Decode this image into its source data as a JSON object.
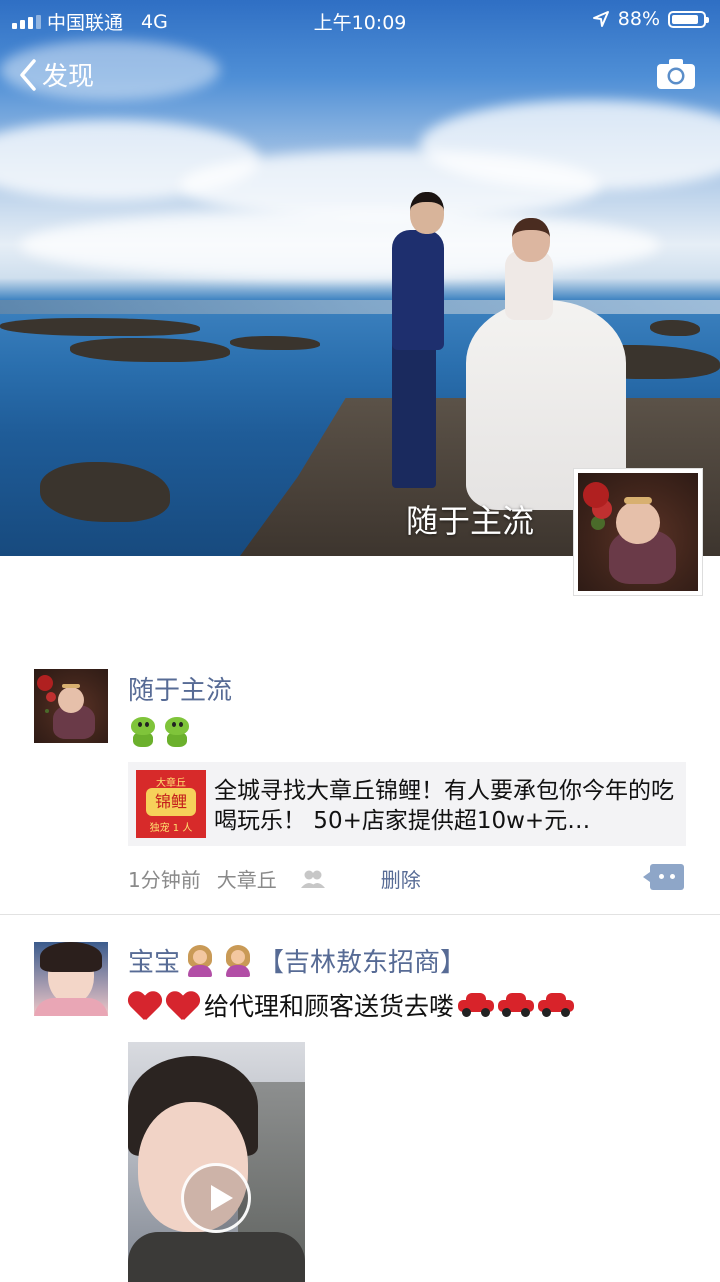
{
  "status_bar": {
    "carrier": "中国联通",
    "network": "4G",
    "time": "上午10:09",
    "battery": "88%",
    "battery_level": 0.88
  },
  "nav": {
    "back_label": "发现",
    "back_icon": "chevron-left-icon",
    "camera_icon": "camera-icon"
  },
  "cover": {
    "user_name": "随于主流"
  },
  "posts": [
    {
      "name": "随于主流",
      "emoji": [
        "frog-emoji",
        "frog-emoji"
      ],
      "link": {
        "thumb_top": "大章丘",
        "thumb_mid": "锦鲤",
        "thumb_bot": "独宠 1 人",
        "title": "全城寻找大章丘锦鲤！有人要承包你今年的吃喝玩乐！ 50+店家提供超10w+元…"
      },
      "time": "1分钟前",
      "location": "大章丘",
      "privacy_icon": "friends-icon",
      "delete_label": "删除",
      "comment_icon": "comment-icon"
    },
    {
      "name_main": "宝宝",
      "name_tag": "【吉林敖东招商】",
      "text": "给代理和顾客送货去喽",
      "video_icon": "play-icon"
    }
  ]
}
